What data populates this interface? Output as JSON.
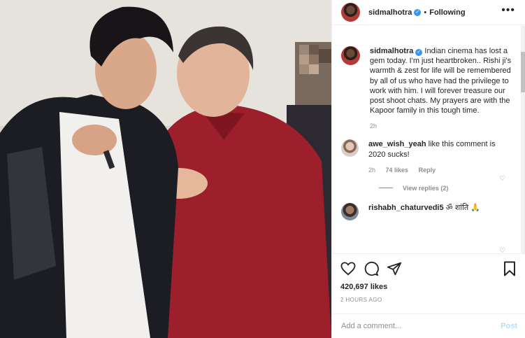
{
  "header": {
    "username": "sidmalhotra",
    "separator": "•",
    "follow_label": "Following",
    "more_label": "•••"
  },
  "caption": {
    "username": "sidmalhotra",
    "text": "Indian cinema has lost a gem today. I'm just heartbroken.. Rishi ji's warmth & zest for life will be remembered by all of us who have had the privilege to work with him. I will forever treasure our post shoot chats. My prayers are with the Kapoor family in this tough time.",
    "time": "2h"
  },
  "comments": [
    {
      "username": "awe_wish_yeah",
      "text": "like this comment is 2020 sucks!",
      "time": "2h",
      "likes": "74 likes",
      "reply_label": "Reply",
      "view_replies": "View replies (2)"
    },
    {
      "username": "rishabh_chaturvedi5",
      "text": "ॐ शांति 🙏"
    }
  ],
  "actions": {
    "likes": "420,697 likes",
    "timestamp": "2 HOURS AGO"
  },
  "add_comment": {
    "placeholder": "Add a comment...",
    "post_label": "Post"
  },
  "colors": {
    "link_blue": "#3897f0",
    "post_disabled": "#b2dffc",
    "muted_text": "#8e8e8e"
  }
}
